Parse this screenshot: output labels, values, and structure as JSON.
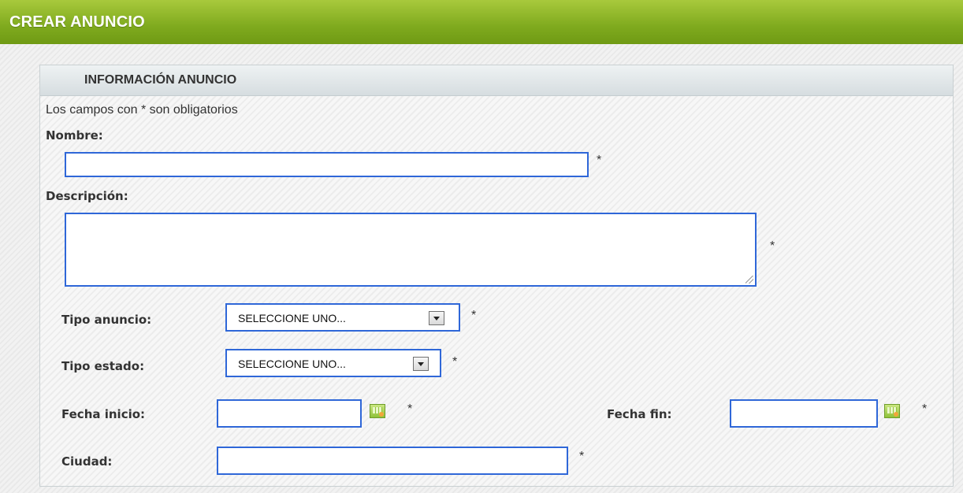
{
  "header": {
    "title": "CREAR ANUNCIO",
    "accent": "#7faa1e"
  },
  "panel": {
    "title": "INFORMACIÓN ANUNCIO",
    "required_note": "Los campos con * son obligatorios"
  },
  "form": {
    "required_marker": "*",
    "nombre": {
      "label": "Nombre:",
      "value": ""
    },
    "descripcion": {
      "label": "Descripción:",
      "value": ""
    },
    "tipo_anuncio": {
      "label": "Tipo anuncio:",
      "selected": "SELECCIONE UNO..."
    },
    "tipo_estado": {
      "label": "Tipo estado:",
      "selected": "SELECCIONE UNO..."
    },
    "fecha_inicio": {
      "label": "Fecha inicio:",
      "value": ""
    },
    "fecha_fin": {
      "label": "Fecha fin:",
      "value": ""
    },
    "ciudad": {
      "label": "Ciudad:",
      "value": ""
    }
  },
  "icons": {
    "calendar": "calendar-icon",
    "dropdown": "chevron-down-icon"
  }
}
